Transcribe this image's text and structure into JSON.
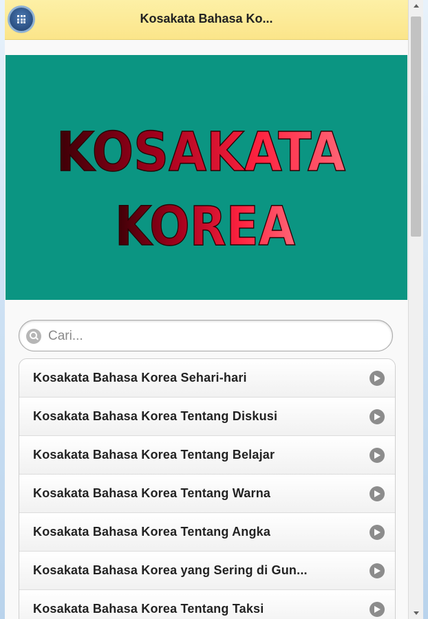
{
  "header": {
    "title": "Kosakata Bahasa Ko...",
    "menu_icon": "grid-menu-icon"
  },
  "banner": {
    "line1": "KOSAKATA",
    "line2": "KOREA",
    "background": "#0b9582",
    "text_color": "#e8102e"
  },
  "search": {
    "placeholder": "Cari...",
    "value": "",
    "icon": "search-icon"
  },
  "list": {
    "items": [
      {
        "label": "Kosakata Bahasa Korea Sehari-hari"
      },
      {
        "label": "Kosakata Bahasa Korea Tentang Diskusi"
      },
      {
        "label": "Kosakata Bahasa Korea Tentang Belajar"
      },
      {
        "label": "Kosakata Bahasa Korea Tentang Warna"
      },
      {
        "label": "Kosakata Bahasa Korea Tentang Angka"
      },
      {
        "label": "Kosakata Bahasa Korea yang Sering di Gun..."
      },
      {
        "label": "Kosakata Bahasa Korea Tentang Taksi"
      }
    ],
    "item_icon": "chevron-right-icon"
  }
}
